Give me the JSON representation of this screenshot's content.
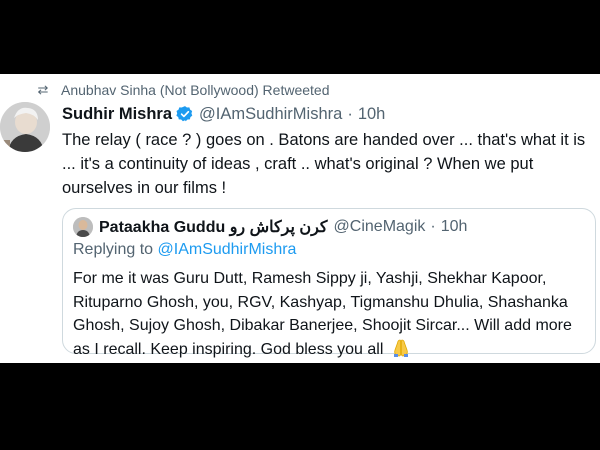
{
  "retweet": {
    "label": "Anubhav Sinha (Not Bollywood) Retweeted",
    "icon": "retweet-icon"
  },
  "tweet": {
    "author_name": "Sudhir Mishra",
    "handle": "@IAmSudhirMishra",
    "separator": "·",
    "time": "10h",
    "text": "The relay ( race ? ) goes on . Batons are handed over  ... that's what it is ... it's a continuity of ideas , craft .. what's original ? When we put ourselves in our films !"
  },
  "quote": {
    "author_name": "Pataakha Guddu کرن پرکاش رو",
    "handle": "@CineMagik",
    "separator": "·",
    "time": "10h",
    "replying_prefix": "Replying to",
    "replying_to": "@IAmSudhirMishra",
    "text": "For me it was Guru Dutt, Ramesh Sippy ji, Yashji, Shekhar Kapoor, Rituparno Ghosh, you, RGV, Kashyap, Tigmanshu Dhulia, Shashanka Ghosh, Sujoy Ghosh, Dibakar Banerjee, Shoojit Sircar... Will add more as I recall. Keep inspiring. God bless you all",
    "emoji": "folded-hands-icon"
  },
  "colors": {
    "background": "#000000",
    "card": "#ffffff",
    "text": "#0f1419",
    "secondary": "#536471",
    "accent": "#1d9bf0",
    "border": "#cfd9de"
  }
}
